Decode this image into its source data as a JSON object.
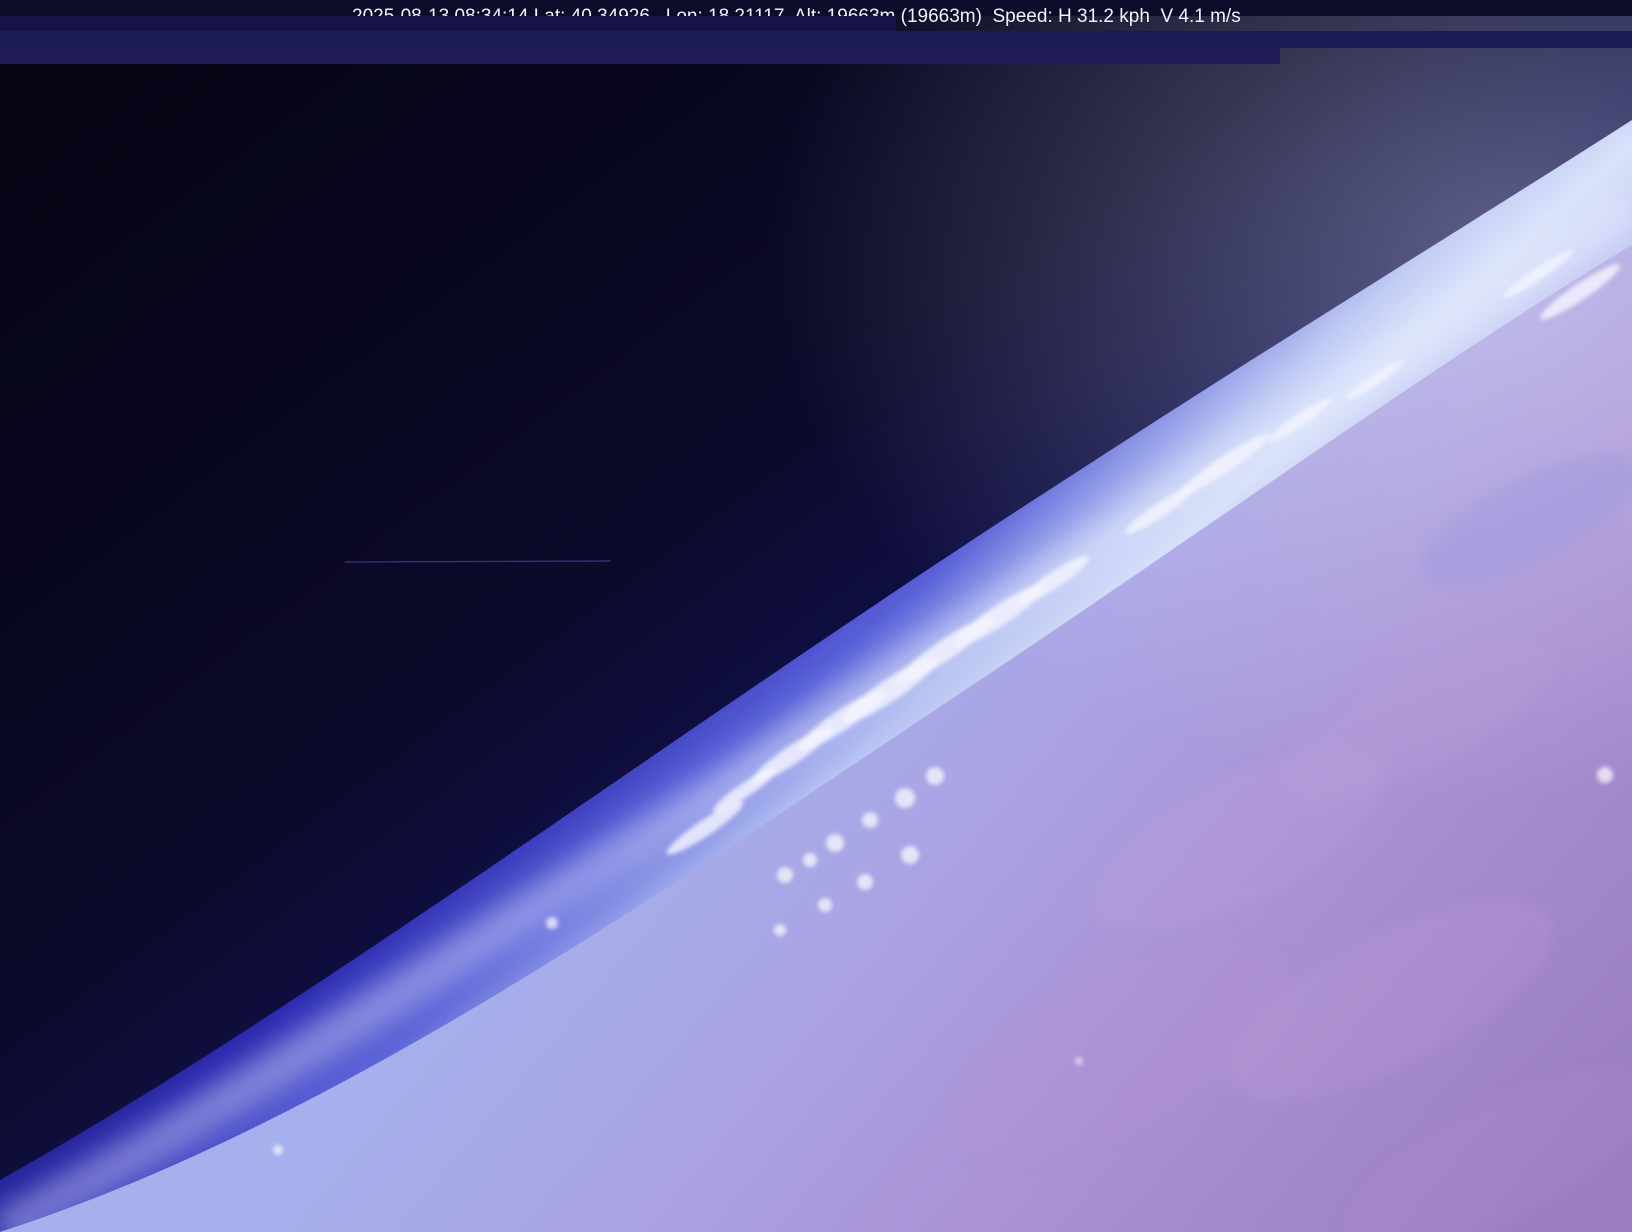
{
  "telemetry": {
    "overlay_text": "2025-08-13 08:34:14 Lat: 40.34926   Lon: 18.21117  Alt: 19663m (19663m)  Speed: H 31.2 kph  V 4.1 m/s"
  },
  "scene": {
    "subject": "earth-limb-from-stratosphere"
  },
  "colors": {
    "space": "#05040f",
    "upper_atmosphere": "#1b1a7a",
    "limb_glow": "#c9d4f4",
    "haze": "#9ea8e8",
    "ground": "#a98ed0",
    "telemetry_text": "#f4f2ff"
  }
}
